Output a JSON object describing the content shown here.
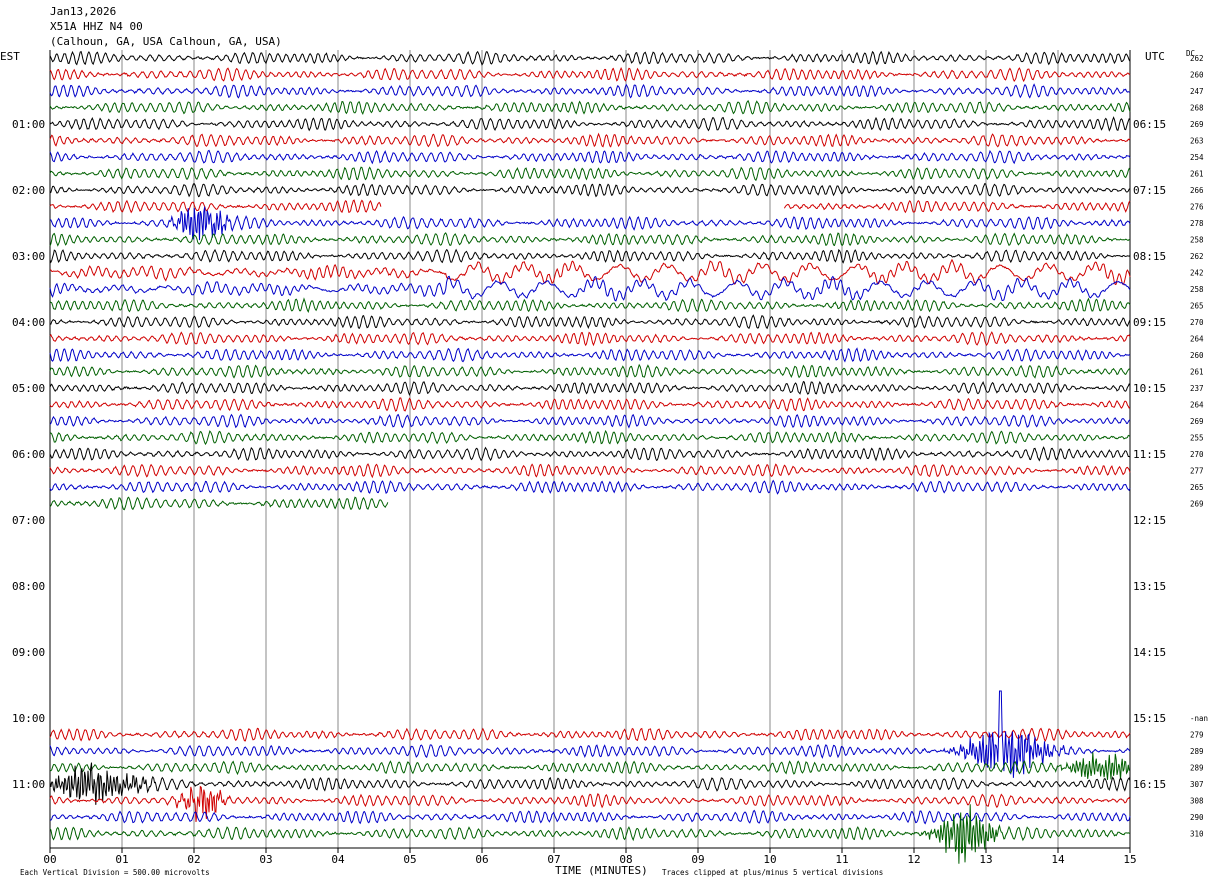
{
  "header": {
    "date": "Jan13,2026",
    "station": "X51A HHZ N4 00",
    "location": "(Calhoun, GA, USA Calhoun, GA, USA)"
  },
  "left_timezone": "EST",
  "right_timezone": "UTC",
  "dc_header": "DC",
  "colors": {
    "black": "#000000",
    "red": "#d00000",
    "blue": "#0000c8",
    "green": "#006000",
    "grid": "#888888"
  },
  "chart_data": {
    "type": "line",
    "description_kind": "helicorder",
    "x_axis": {
      "label": "TIME (MINUTES)",
      "range": [
        0,
        15
      ],
      "ticks": [
        "00",
        "01",
        "02",
        "03",
        "04",
        "05",
        "06",
        "07",
        "08",
        "09",
        "10",
        "11",
        "12",
        "13",
        "14",
        "15"
      ]
    },
    "left_hour_labels": [
      "01:00",
      "02:00",
      "03:00",
      "04:00",
      "05:00",
      "06:00",
      "07:00",
      "08:00",
      "09:00",
      "10:00",
      "11:00"
    ],
    "right_hour_labels": [
      "06:15",
      "07:15",
      "08:15",
      "09:15",
      "10:15",
      "11:15",
      "12:15",
      "13:15",
      "14:15",
      "15:15",
      "16:15"
    ],
    "traces_per_hour": 4,
    "trace_color_cycle": [
      "black",
      "red",
      "blue",
      "green"
    ],
    "rows": [
      {
        "hour": 0,
        "slot": 0,
        "dc": "262",
        "start": 0,
        "end": 15
      },
      {
        "hour": 0,
        "slot": 1,
        "dc": "260",
        "start": 0,
        "end": 15
      },
      {
        "hour": 0,
        "slot": 2,
        "dc": "247",
        "start": 0,
        "end": 15
      },
      {
        "hour": 0,
        "slot": 3,
        "dc": "268",
        "start": 0,
        "end": 15
      },
      {
        "hour": 1,
        "slot": 0,
        "dc": "269",
        "start": 0,
        "end": 15
      },
      {
        "hour": 1,
        "slot": 1,
        "dc": "263",
        "start": 0,
        "end": 15
      },
      {
        "hour": 1,
        "slot": 2,
        "dc": "254",
        "start": 0,
        "end": 15
      },
      {
        "hour": 1,
        "slot": 3,
        "dc": "261",
        "start": 0,
        "end": 15
      },
      {
        "hour": 2,
        "slot": 0,
        "dc": "266",
        "start": 0,
        "end": 15
      },
      {
        "hour": 2,
        "slot": 1,
        "dc": "276",
        "start": 0,
        "end": 15,
        "gap": [
          4.6,
          10.2
        ]
      },
      {
        "hour": 2,
        "slot": 2,
        "dc": "278",
        "start": 0,
        "end": 15,
        "burst": [
          2.1,
          0.3,
          3
        ]
      },
      {
        "hour": 2,
        "slot": 3,
        "dc": "258",
        "start": 0,
        "end": 15
      },
      {
        "hour": 3,
        "slot": 0,
        "dc": "262",
        "start": 0,
        "end": 15
      },
      {
        "hour": 3,
        "slot": 1,
        "dc": "242",
        "start": 0,
        "end": 15,
        "swell": true
      },
      {
        "hour": 3,
        "slot": 2,
        "dc": "258",
        "start": 0,
        "end": 15,
        "swell": true
      },
      {
        "hour": 3,
        "slot": 3,
        "dc": "265",
        "start": 0,
        "end": 15
      },
      {
        "hour": 4,
        "slot": 0,
        "dc": "270",
        "start": 0,
        "end": 15
      },
      {
        "hour": 4,
        "slot": 1,
        "dc": "264",
        "start": 0,
        "end": 15
      },
      {
        "hour": 4,
        "slot": 2,
        "dc": "260",
        "start": 0,
        "end": 15
      },
      {
        "hour": 4,
        "slot": 3,
        "dc": "261",
        "start": 0,
        "end": 15
      },
      {
        "hour": 5,
        "slot": 0,
        "dc": "237",
        "start": 0,
        "end": 15
      },
      {
        "hour": 5,
        "slot": 1,
        "dc": "264",
        "start": 0,
        "end": 15
      },
      {
        "hour": 5,
        "slot": 2,
        "dc": "269",
        "start": 0,
        "end": 15
      },
      {
        "hour": 5,
        "slot": 3,
        "dc": "255",
        "start": 0,
        "end": 15
      },
      {
        "hour": 6,
        "slot": 0,
        "dc": "270",
        "start": 0,
        "end": 15
      },
      {
        "hour": 6,
        "slot": 1,
        "dc": "277",
        "start": 0,
        "end": 15
      },
      {
        "hour": 6,
        "slot": 2,
        "dc": "265",
        "start": 0,
        "end": 15
      },
      {
        "hour": 6,
        "slot": 3,
        "dc": "269",
        "start": 0,
        "end": 4.7
      },
      {
        "hour": 10,
        "slot": 0,
        "dc": "-nan",
        "start": 0,
        "end": 0
      },
      {
        "hour": 10,
        "slot": 1,
        "dc": "279",
        "start": 0,
        "end": 15
      },
      {
        "hour": 10,
        "slot": 2,
        "dc": "289",
        "start": 0,
        "end": 15,
        "burst": [
          13.3,
          0.5,
          4
        ],
        "spike": 13.2
      },
      {
        "hour": 10,
        "slot": 3,
        "dc": "289",
        "start": 0,
        "end": 15,
        "burst": [
          14.6,
          0.4,
          2
        ]
      },
      {
        "hour": 11,
        "slot": 0,
        "dc": "307",
        "start": 0,
        "end": 15,
        "burst": [
          0.6,
          0.6,
          2.5
        ]
      },
      {
        "hour": 11,
        "slot": 1,
        "dc": "308",
        "start": 0,
        "end": 15,
        "burst": [
          2.1,
          0.25,
          2.5
        ]
      },
      {
        "hour": 11,
        "slot": 2,
        "dc": "290",
        "start": 0,
        "end": 15
      },
      {
        "hour": 11,
        "slot": 3,
        "dc": "310",
        "start": 0,
        "end": 15,
        "burst": [
          12.7,
          0.35,
          4
        ]
      }
    ]
  },
  "footer": {
    "scale_note": "Each Vertical Division =  500.00 microvolts",
    "clip_note": "Traces clipped at plus/minus 5 vertical divisions"
  }
}
